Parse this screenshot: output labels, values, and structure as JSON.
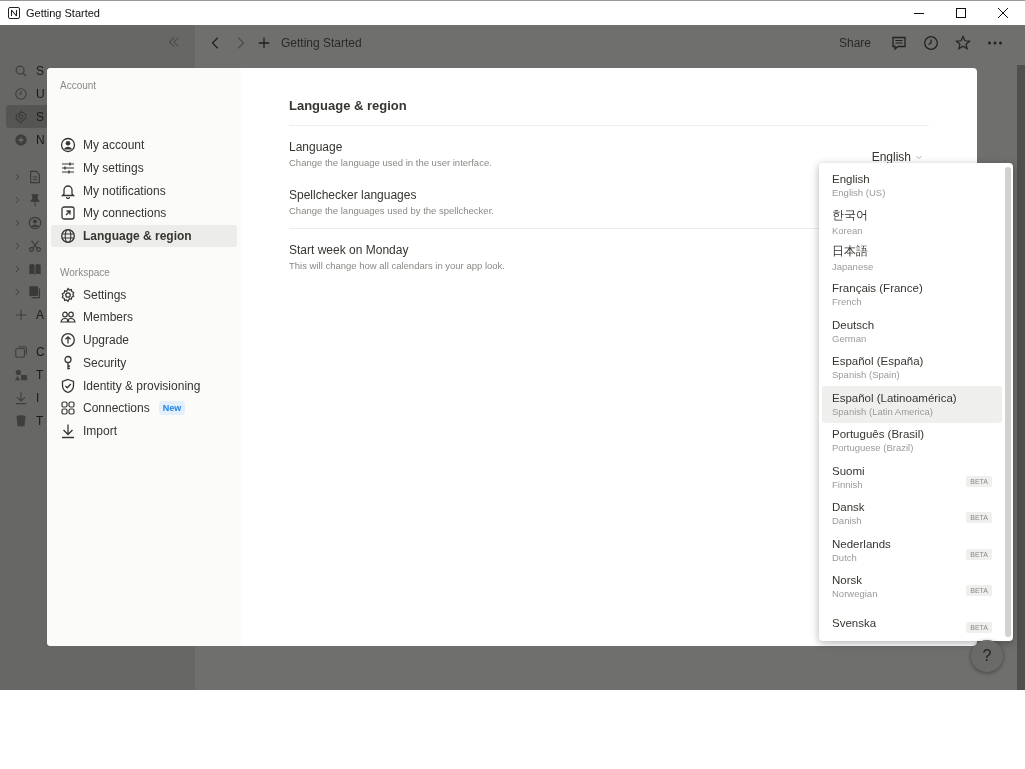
{
  "window": {
    "title": "Getting Started"
  },
  "topbar": {
    "breadcrumb": "Getting Started",
    "share": "Share"
  },
  "background_sidebar": {
    "top_items": [
      {
        "label": "S",
        "selected": false
      },
      {
        "label": "U",
        "selected": false
      },
      {
        "label": "S",
        "selected": true
      },
      {
        "label": "N",
        "selected": false
      }
    ],
    "bottom_items": [
      {
        "label": "A"
      },
      {
        "label": "C"
      },
      {
        "label": "T"
      },
      {
        "label": "I"
      },
      {
        "label": "T"
      }
    ]
  },
  "settings": {
    "account_heading": "Account",
    "account_items": [
      {
        "label": "My account",
        "selected": false
      },
      {
        "label": "My settings",
        "selected": false
      },
      {
        "label": "My notifications",
        "selected": false
      },
      {
        "label": "My connections",
        "selected": false
      },
      {
        "label": "Language & region",
        "selected": true
      }
    ],
    "workspace_heading": "Workspace",
    "workspace_items": [
      {
        "label": "Settings",
        "selected": false
      },
      {
        "label": "Members",
        "selected": false
      },
      {
        "label": "Upgrade",
        "selected": false
      },
      {
        "label": "Security",
        "selected": false
      },
      {
        "label": "Identity & provisioning",
        "selected": false
      },
      {
        "label": "Connections",
        "selected": false,
        "badge": "New"
      },
      {
        "label": "Import",
        "selected": false
      }
    ],
    "title": "Language & region",
    "groups": [
      [
        {
          "title": "Language",
          "description": "Change the language used in the user interface.",
          "value": "English"
        },
        {
          "title": "Spellchecker languages",
          "description": "Change the languages used by the spellchecker."
        }
      ],
      [
        {
          "title": "Start week on Monday",
          "description": "This will change how all calendars in your app look."
        }
      ]
    ]
  },
  "language_menu": [
    {
      "name": "English",
      "subtitle": "English (US)",
      "selected": false
    },
    {
      "name": "한국어",
      "subtitle": "Korean",
      "selected": false
    },
    {
      "name": "日本語",
      "subtitle": "Japanese",
      "selected": false
    },
    {
      "name": "Français (France)",
      "subtitle": "French",
      "selected": false
    },
    {
      "name": "Deutsch",
      "subtitle": "German",
      "selected": false
    },
    {
      "name": "Español (España)",
      "subtitle": "Spanish (Spain)",
      "selected": false
    },
    {
      "name": "Español (Latinoamérica)",
      "subtitle": "Spanish (Latin America)",
      "selected": true
    },
    {
      "name": "Português (Brasil)",
      "subtitle": "Portuguese (Brazil)",
      "selected": false
    },
    {
      "name": "Suomi",
      "subtitle": "Finnish",
      "selected": false,
      "badge": "BETA"
    },
    {
      "name": "Dansk",
      "subtitle": "Danish",
      "selected": false,
      "badge": "BETA"
    },
    {
      "name": "Nederlands",
      "subtitle": "Dutch",
      "selected": false,
      "badge": "BETA"
    },
    {
      "name": "Norsk",
      "subtitle": "Norwegian",
      "selected": false,
      "badge": "BETA"
    },
    {
      "name": "Svenska",
      "selected": false,
      "badge": "BETA"
    }
  ],
  "help": "?"
}
